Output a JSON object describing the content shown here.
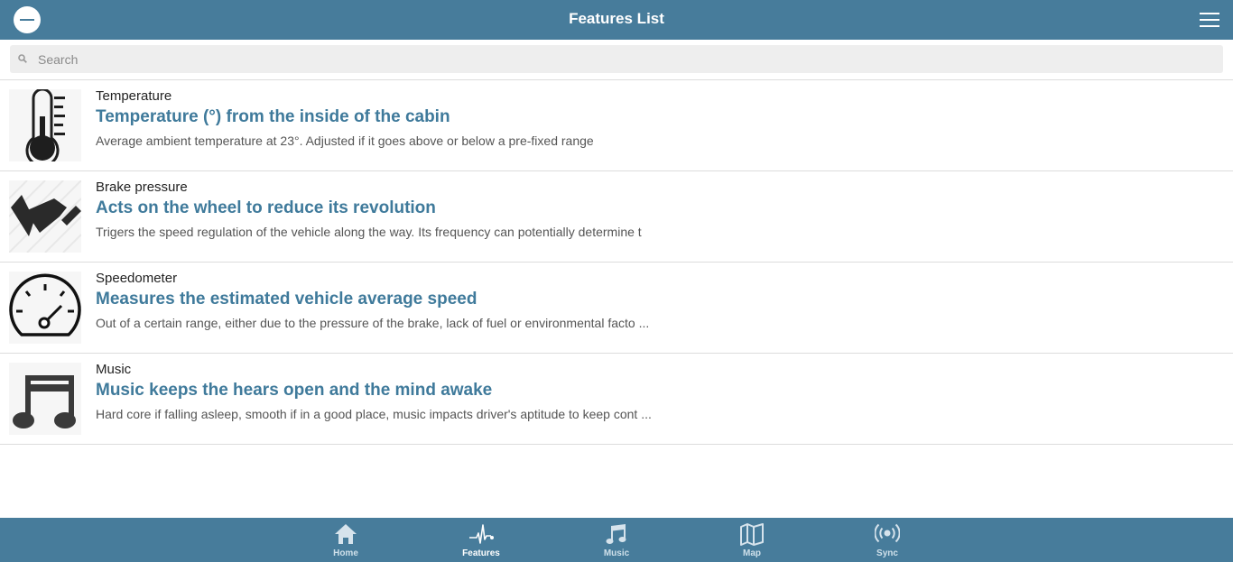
{
  "header": {
    "title": "Features List"
  },
  "search": {
    "placeholder": "Search",
    "value": ""
  },
  "items": [
    {
      "category": "Temperature",
      "title": "Temperature (°) from the inside of the cabin",
      "description": "Average ambient temperature at 23°. Adjusted if it goes above or below a pre-fixed range",
      "icon": "thermometer-icon"
    },
    {
      "category": "Brake pressure",
      "title": "Acts on the wheel to reduce its revolution",
      "description": "Trigers the speed regulation of the vehicle along the way. Its frequency can potentially determine t",
      "icon": "brake-pedal-icon"
    },
    {
      "category": "Speedometer",
      "title": "Measures the estimated vehicle average speed",
      "description": "Out of a certain range, either due to the pressure of the brake, lack of fuel or environmental facto ...",
      "icon": "speedometer-icon"
    },
    {
      "category": "Music",
      "title": "Music keeps the hears open and the mind awake",
      "description": "Hard core if falling asleep, smooth if in a good place, music impacts driver's aptitude to keep cont ...",
      "icon": "music-note-icon"
    }
  ],
  "footer": {
    "tabs": [
      {
        "label": "Home",
        "icon": "home-icon"
      },
      {
        "label": "Features",
        "icon": "pulse-icon",
        "active": true
      },
      {
        "label": "Music",
        "icon": "music-icon"
      },
      {
        "label": "Map",
        "icon": "map-icon"
      },
      {
        "label": "Sync",
        "icon": "broadcast-icon"
      }
    ]
  },
  "colors": {
    "bar": "#477c9b",
    "title_accent": "#3f7a9b",
    "search_bg": "#eeeeee"
  }
}
